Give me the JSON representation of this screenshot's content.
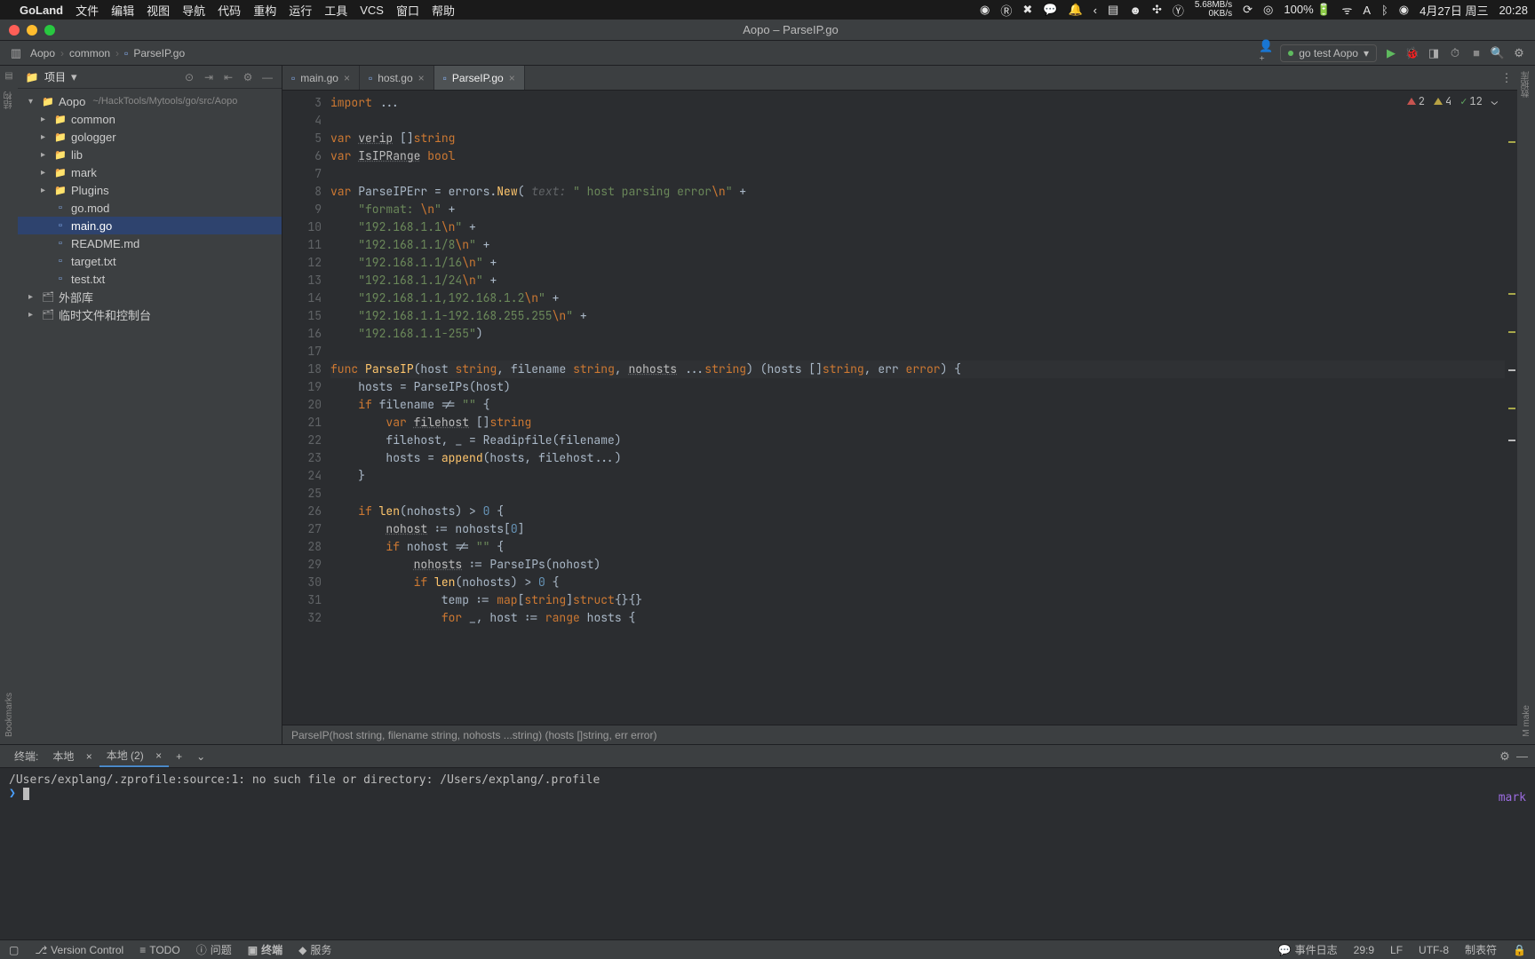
{
  "mac": {
    "app": "GoLand",
    "menus": [
      "文件",
      "编辑",
      "视图",
      "导航",
      "代码",
      "重构",
      "运行",
      "工具",
      "VCS",
      "窗口",
      "帮助"
    ],
    "netspeed_up": "5.68MB/s",
    "netspeed_down": "0KB/s",
    "battery": "100%",
    "date": "4月27日 周三",
    "time": "20:28"
  },
  "window": {
    "title": "Aopo – ParseIP.go"
  },
  "toolbar": {
    "crumbs": [
      "Aopo",
      "common",
      "ParseIP.go"
    ],
    "run_config": "go test Aopo"
  },
  "project": {
    "title": "项目",
    "root_name": "Aopo",
    "root_path": "~/HackTools/Mytools/go/src/Aopo",
    "children": [
      {
        "name": "common",
        "type": "folder"
      },
      {
        "name": "gologger",
        "type": "folder"
      },
      {
        "name": "lib",
        "type": "folder"
      },
      {
        "name": "mark",
        "type": "folder"
      },
      {
        "name": "Plugins",
        "type": "folder"
      },
      {
        "name": "go.mod",
        "type": "file"
      },
      {
        "name": "main.go",
        "type": "file",
        "selected": true
      },
      {
        "name": "README.md",
        "type": "file"
      },
      {
        "name": "target.txt",
        "type": "file"
      },
      {
        "name": "test.txt",
        "type": "file"
      }
    ],
    "extra": [
      {
        "name": "外部库"
      },
      {
        "name": "临时文件和控制台"
      }
    ]
  },
  "tabs": [
    {
      "name": "main.go",
      "active": false
    },
    {
      "name": "host.go",
      "active": false
    },
    {
      "name": "ParseIP.go",
      "active": true
    }
  ],
  "inspections": {
    "errors": 2,
    "warnings": 4,
    "typos": 12
  },
  "code": {
    "first_line": 3,
    "lines": [
      {
        "t": [
          {
            "c": "kw",
            "s": "import"
          },
          {
            "c": "id",
            "s": " ..."
          }
        ]
      },
      {
        "t": []
      },
      {
        "t": [
          {
            "c": "kw",
            "s": "var"
          },
          {
            "c": "id",
            "s": " "
          },
          {
            "c": "und",
            "s": "verip"
          },
          {
            "c": "id",
            "s": " []"
          },
          {
            "c": "typ",
            "s": "string"
          }
        ]
      },
      {
        "t": [
          {
            "c": "kw",
            "s": "var"
          },
          {
            "c": "id",
            "s": " "
          },
          {
            "c": "und",
            "s": "IsIPRange"
          },
          {
            "c": "id",
            "s": " "
          },
          {
            "c": "typ",
            "s": "bool"
          }
        ]
      },
      {
        "t": []
      },
      {
        "t": [
          {
            "c": "kw",
            "s": "var"
          },
          {
            "c": "id",
            "s": " ParseIPErr = errors."
          },
          {
            "c": "fn",
            "s": "New"
          },
          {
            "c": "id",
            "s": "( "
          },
          {
            "c": "hint",
            "s": "text:"
          },
          {
            "c": "id",
            "s": " "
          },
          {
            "c": "str",
            "s": "\" host parsing error"
          },
          {
            "c": "esc",
            "s": "\\n"
          },
          {
            "c": "str",
            "s": "\""
          },
          {
            "c": "id",
            "s": " +"
          }
        ]
      },
      {
        "t": [
          {
            "c": "id",
            "s": "    "
          },
          {
            "c": "str",
            "s": "\"format: "
          },
          {
            "c": "esc",
            "s": "\\n"
          },
          {
            "c": "str",
            "s": "\""
          },
          {
            "c": "id",
            "s": " +"
          }
        ]
      },
      {
        "t": [
          {
            "c": "id",
            "s": "    "
          },
          {
            "c": "str",
            "s": "\"192.168.1.1"
          },
          {
            "c": "esc",
            "s": "\\n"
          },
          {
            "c": "str",
            "s": "\""
          },
          {
            "c": "id",
            "s": " +"
          }
        ]
      },
      {
        "t": [
          {
            "c": "id",
            "s": "    "
          },
          {
            "c": "str",
            "s": "\"192.168.1.1/8"
          },
          {
            "c": "esc",
            "s": "\\n"
          },
          {
            "c": "str",
            "s": "\""
          },
          {
            "c": "id",
            "s": " +"
          }
        ]
      },
      {
        "t": [
          {
            "c": "id",
            "s": "    "
          },
          {
            "c": "str",
            "s": "\"192.168.1.1/16"
          },
          {
            "c": "esc",
            "s": "\\n"
          },
          {
            "c": "str",
            "s": "\""
          },
          {
            "c": "id",
            "s": " +"
          }
        ]
      },
      {
        "t": [
          {
            "c": "id",
            "s": "    "
          },
          {
            "c": "str",
            "s": "\"192.168.1.1/24"
          },
          {
            "c": "esc",
            "s": "\\n"
          },
          {
            "c": "str",
            "s": "\""
          },
          {
            "c": "id",
            "s": " +"
          }
        ]
      },
      {
        "t": [
          {
            "c": "id",
            "s": "    "
          },
          {
            "c": "str",
            "s": "\"192.168.1.1,192.168.1.2"
          },
          {
            "c": "esc",
            "s": "\\n"
          },
          {
            "c": "str",
            "s": "\""
          },
          {
            "c": "id",
            "s": " +"
          }
        ]
      },
      {
        "t": [
          {
            "c": "id",
            "s": "    "
          },
          {
            "c": "str",
            "s": "\"192.168.1.1-192.168.255.255"
          },
          {
            "c": "esc",
            "s": "\\n"
          },
          {
            "c": "str",
            "s": "\""
          },
          {
            "c": "id",
            "s": " +"
          }
        ]
      },
      {
        "t": [
          {
            "c": "id",
            "s": "    "
          },
          {
            "c": "str",
            "s": "\"192.168.1.1-255\""
          },
          {
            "c": "id",
            "s": ")"
          }
        ]
      },
      {
        "t": []
      },
      {
        "t": [
          {
            "c": "kw",
            "s": "func"
          },
          {
            "c": "id",
            "s": " "
          },
          {
            "c": "fn",
            "s": "ParseIP"
          },
          {
            "c": "id",
            "s": "(host "
          },
          {
            "c": "typ",
            "s": "string"
          },
          {
            "c": "id",
            "s": ", filename "
          },
          {
            "c": "typ",
            "s": "string"
          },
          {
            "c": "id",
            "s": ", "
          },
          {
            "c": "und",
            "s": "nohosts"
          },
          {
            "c": "id",
            "s": " ..."
          },
          {
            "c": "typ",
            "s": "string"
          },
          {
            "c": "id",
            "s": ") (hosts []"
          },
          {
            "c": "typ",
            "s": "string"
          },
          {
            "c": "id",
            "s": ", err "
          },
          {
            "c": "typ",
            "s": "error"
          },
          {
            "c": "id",
            "s": ") {"
          }
        ],
        "hl": true
      },
      {
        "t": [
          {
            "c": "id",
            "s": "    hosts = ParseIPs(host)"
          }
        ]
      },
      {
        "t": [
          {
            "c": "id",
            "s": "    "
          },
          {
            "c": "kw",
            "s": "if"
          },
          {
            "c": "id",
            "s": " filename != "
          },
          {
            "c": "str",
            "s": "\"\""
          },
          {
            "c": "id",
            "s": " {"
          }
        ]
      },
      {
        "t": [
          {
            "c": "id",
            "s": "        "
          },
          {
            "c": "kw",
            "s": "var"
          },
          {
            "c": "id",
            "s": " "
          },
          {
            "c": "und",
            "s": "filehost"
          },
          {
            "c": "id",
            "s": " []"
          },
          {
            "c": "typ",
            "s": "string"
          }
        ]
      },
      {
        "t": [
          {
            "c": "id",
            "s": "        filehost, _ = Readipfile(filename)"
          }
        ]
      },
      {
        "t": [
          {
            "c": "id",
            "s": "        hosts = "
          },
          {
            "c": "fn",
            "s": "append"
          },
          {
            "c": "id",
            "s": "(hosts, filehost...)"
          }
        ]
      },
      {
        "t": [
          {
            "c": "id",
            "s": "    }"
          }
        ]
      },
      {
        "t": []
      },
      {
        "t": [
          {
            "c": "id",
            "s": "    "
          },
          {
            "c": "kw",
            "s": "if"
          },
          {
            "c": "id",
            "s": " "
          },
          {
            "c": "fn",
            "s": "len"
          },
          {
            "c": "id",
            "s": "(nohosts) > "
          },
          {
            "c": "num",
            "s": "0"
          },
          {
            "c": "id",
            "s": " {"
          }
        ]
      },
      {
        "t": [
          {
            "c": "id",
            "s": "        "
          },
          {
            "c": "und",
            "s": "nohost"
          },
          {
            "c": "id",
            "s": " := nohosts["
          },
          {
            "c": "num",
            "s": "0"
          },
          {
            "c": "id",
            "s": "]"
          }
        ]
      },
      {
        "t": [
          {
            "c": "id",
            "s": "        "
          },
          {
            "c": "kw",
            "s": "if"
          },
          {
            "c": "id",
            "s": " nohost != "
          },
          {
            "c": "str",
            "s": "\"\""
          },
          {
            "c": "id",
            "s": " {"
          }
        ]
      },
      {
        "t": [
          {
            "c": "id",
            "s": "            "
          },
          {
            "c": "und",
            "s": "nohosts"
          },
          {
            "c": "id",
            "s": " := ParseIPs(nohost)"
          }
        ]
      },
      {
        "t": [
          {
            "c": "id",
            "s": "            "
          },
          {
            "c": "kw",
            "s": "if"
          },
          {
            "c": "id",
            "s": " "
          },
          {
            "c": "fn",
            "s": "len"
          },
          {
            "c": "id",
            "s": "(nohosts) > "
          },
          {
            "c": "num",
            "s": "0"
          },
          {
            "c": "id",
            "s": " {"
          }
        ]
      },
      {
        "t": [
          {
            "c": "id",
            "s": "                temp := "
          },
          {
            "c": "kw",
            "s": "map"
          },
          {
            "c": "id",
            "s": "["
          },
          {
            "c": "typ",
            "s": "string"
          },
          {
            "c": "id",
            "s": "]"
          },
          {
            "c": "kw",
            "s": "struct"
          },
          {
            "c": "id",
            "s": "{}{}"
          }
        ]
      },
      {
        "t": [
          {
            "c": "id",
            "s": "                "
          },
          {
            "c": "kw",
            "s": "for"
          },
          {
            "c": "id",
            "s": " _, host := "
          },
          {
            "c": "kw",
            "s": "range"
          },
          {
            "c": "id",
            "s": " hosts {"
          }
        ]
      }
    ]
  },
  "breadcrumb": "ParseIP(host string, filename string, nohosts ...string) (hosts []string, err error)",
  "terminal": {
    "title": "终端:",
    "tabs": [
      "本地",
      "本地 (2)"
    ],
    "active": 1,
    "line1": "/Users/explang/.zprofile:source:1: no such file or directory: /Users/explang/.profile",
    "prompt": "❯",
    "right": "mark"
  },
  "statusbar": {
    "vcs": "Version Control",
    "todo": "TODO",
    "problems": "问题",
    "terminal": "终端",
    "services": "服务",
    "event": "事件日志",
    "pos": "29:9",
    "lf": "LF",
    "enc": "UTF-8",
    "indent": "制表符",
    "lock": "🔒"
  },
  "sidestrips": {
    "left": [
      "结构",
      "Bookmarks"
    ],
    "right": [
      "数据库",
      "M make"
    ]
  }
}
